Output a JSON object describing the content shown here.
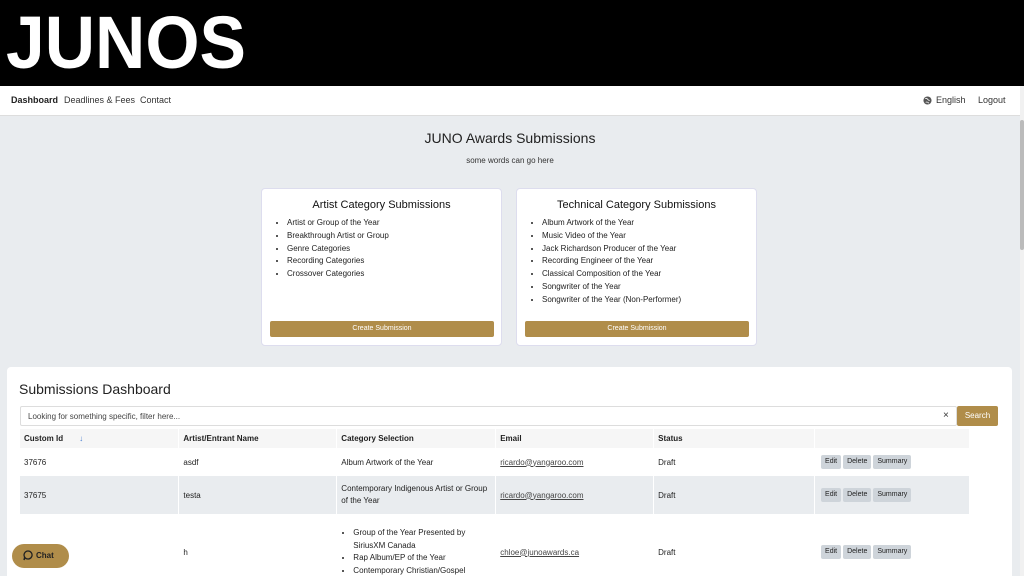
{
  "header": {
    "logo_text": "JUNOS"
  },
  "nav": {
    "items": [
      {
        "label": "Dashboard",
        "active": true
      },
      {
        "label": "Deadlines & Fees"
      },
      {
        "label": "Contact"
      }
    ],
    "language": "English",
    "logout": "Logout"
  },
  "page": {
    "title": "JUNO Awards Submissions",
    "subtitle": "some words can go here"
  },
  "cards": [
    {
      "title": "Artist Category Submissions",
      "items": [
        "Artist or Group of the Year",
        "Breakthrough Artist or Group",
        "Genre Categories",
        "Recording Categories",
        "Crossover Categories"
      ],
      "button": "Create Submission"
    },
    {
      "title": "Technical Category Submissions",
      "items": [
        "Album Artwork of the Year",
        "Music Video of the Year",
        "Jack Richardson Producer of the Year",
        "Recording Engineer of the Year",
        "Classical Composition of the Year",
        "Songwriter of the Year",
        "Songwriter of the Year (Non-Performer)"
      ],
      "button": "Create Submission"
    }
  ],
  "dashboard": {
    "title": "Submissions Dashboard",
    "filter_placeholder": "Looking for something specific, filter here...",
    "clear": "×",
    "search": "Search",
    "columns": [
      "Custom Id",
      "Artist/Entrant Name",
      "Category Selection",
      "Email",
      "Status"
    ],
    "sort_icon": "↓",
    "actions": {
      "edit": "Edit",
      "delete": "Delete",
      "summary": "Summary"
    },
    "rows": [
      {
        "id": "37676",
        "name": "asdf",
        "category": "Album Artwork of the Year",
        "email": "ricardo@yangaroo.com",
        "status": "Draft"
      },
      {
        "id": "37675",
        "name": "testa",
        "category": "Contemporary Indigenous Artist or Group of the Year",
        "email": "ricardo@yangaroo.com",
        "status": "Draft"
      },
      {
        "id": "",
        "name": "h",
        "categories": [
          "Group of the Year Presented by SiriusXM Canada",
          "Rap Album/EP of the Year",
          "Contemporary Christian/Gospel"
        ],
        "email": "chloe@junoawards.ca",
        "status": "Draft"
      }
    ]
  },
  "chat": {
    "label": "Chat",
    "icon": "chat-bubble-icon"
  },
  "colors": {
    "accent": "#b08d4a",
    "header_bg": "#000000",
    "page_bg": "#e9ecef"
  }
}
